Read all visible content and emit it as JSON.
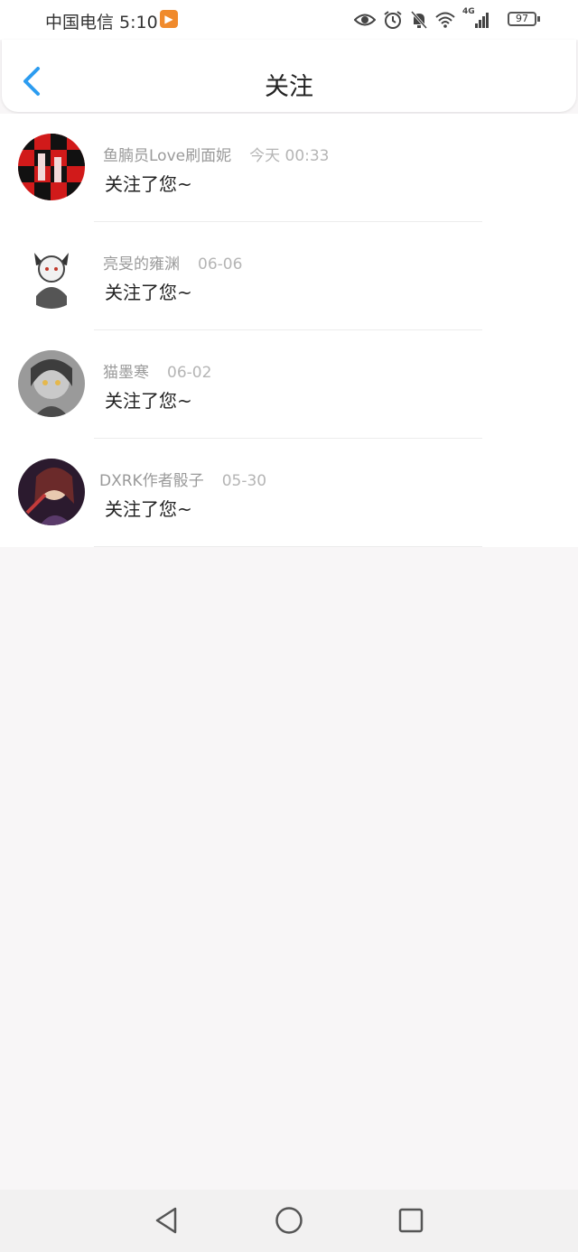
{
  "status_bar": {
    "carrier_time": "中国电信 5:10",
    "network": "4G",
    "battery": "97",
    "icons": [
      "app-notification-icon",
      "eye-icon",
      "alarm-icon",
      "mute-icon",
      "wifi-icon",
      "signal-icon",
      "battery-icon"
    ]
  },
  "header": {
    "title": "关注",
    "back_icon": "chevron-left-icon",
    "accent": "#2c9cf0"
  },
  "items": [
    {
      "name": "鱼腩员Love刷面妮",
      "time": "今天 00:33",
      "action": "关注了您~"
    },
    {
      "name": "亮旻的雍渊",
      "time": "06-06",
      "action": "关注了您~"
    },
    {
      "name": "猫墨寒",
      "time": "06-02",
      "action": "关注了您~"
    },
    {
      "name": "DXRK作者骰子",
      "time": "05-30",
      "action": "关注了您~"
    }
  ],
  "nav": {
    "icons": [
      "back-triangle-icon",
      "home-circle-icon",
      "recent-square-icon"
    ]
  }
}
